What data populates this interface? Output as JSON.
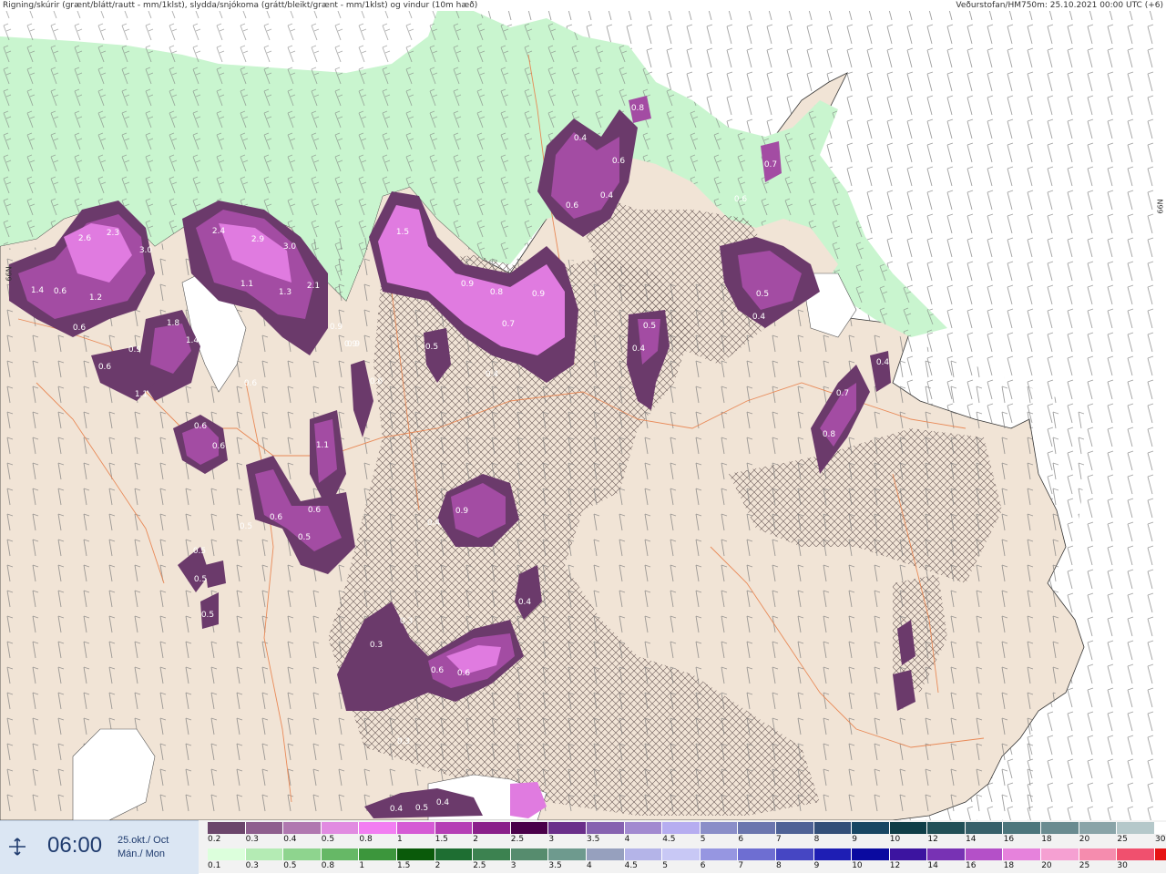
{
  "header": {
    "left_title": "Rigning/skúrir (grænt/blátt/rautt - mm/1klst), slydda/snjókoma (grátt/bleikt/grænt - mm/1klst) og vindur (10m hæð)",
    "right_title": "Veðurstofan/HM750m: 25.10.2021 00:00 UTC (+6)"
  },
  "map": {
    "lat_label_left": "66N",
    "lat_label_right": "66N",
    "colors": {
      "sea": "#ffffff",
      "land": "#f1e4d6",
      "rain_light": "#c9f5cf",
      "rain_mid": "#a6e0ad",
      "snow_dark": "#6b3a6b",
      "snow_mid": "#a34ca3",
      "snow_light": "#e07be0",
      "snow_bright": "#f5a3f5",
      "roads": "#e8804a"
    },
    "precip_labels": [
      "2.6",
      "2.3",
      "3.0",
      "2.4",
      "2.9",
      "3.0",
      "1.4",
      "0.6",
      "1.2",
      "0.6",
      "2.1",
      "1.1",
      "1.3",
      "1.8",
      "0.9",
      "1.4",
      "0.6",
      "1.1",
      "0.6",
      "1.5",
      "0.9",
      "0.8",
      "0.9",
      "0.7",
      "0.4",
      "0.5",
      "0.4",
      "0.4",
      "0.6",
      "0.6",
      "0.8",
      "0.4",
      "0.5",
      "0.4",
      "0.7",
      "0.8",
      "0.6",
      "0.5",
      "0.4",
      "0.6",
      "0.9",
      "0.6",
      "1.1",
      "0.6",
      "0.6",
      "0.5",
      "0.9",
      "0.4",
      "0.4",
      "0.5",
      "0.5",
      "0.5",
      "0.5",
      "0.3",
      "0.6",
      "0.6",
      "0.3",
      "0.3",
      "0.4",
      "0.5",
      "0.4",
      "0.7",
      "0.6",
      "0.9",
      "0.9"
    ]
  },
  "info": {
    "time": "06:00",
    "date_line1": "25.okt./ Oct",
    "date_line2": "Mán./ Mon",
    "icon": "snow-rain-icon"
  },
  "legend": {
    "snow_colors": [
      "#6b466b",
      "#8e5f8e",
      "#b078b0",
      "#e18be1",
      "#f27ef2",
      "#d55bd5",
      "#b53fb5",
      "#8a208a",
      "#4a004a",
      "#6a2f8a",
      "#8662b0",
      "#a28ad0",
      "#b6adf0",
      "#8a8ec8",
      "#6b76ae",
      "#4e6296",
      "#324f79",
      "#174663",
      "#0f3e48",
      "#214f57",
      "#37606a",
      "#4d767c",
      "#6a8b90",
      "#8aa4a8",
      "#b5c8ca",
      "#ffffff"
    ],
    "snow_labels": [
      "0.2",
      "0.3",
      "0.4",
      "0.5",
      "0.8",
      "1",
      "1.5",
      "2",
      "2.5",
      "3",
      "3.5",
      "4",
      "4.5",
      "5",
      "6",
      "7",
      "8",
      "9",
      "10",
      "12",
      "14",
      "16",
      "18",
      "20",
      "25",
      "30"
    ],
    "rain_colors": [
      "#dcffdc",
      "#b4ebb4",
      "#8ed48e",
      "#66b866",
      "#3c963c",
      "#0a5a0a",
      "#1e6e32",
      "#3c8250",
      "#568c6e",
      "#6e9a8e",
      "#96a0be",
      "#b4b4e8",
      "#c8c8f5",
      "#9696e1",
      "#6e6ed2",
      "#4646c3",
      "#1e1eb4",
      "#0a0aa0",
      "#3c14a0",
      "#7832b4",
      "#b450c8",
      "#e682dc",
      "#f5a0d2",
      "#f58cae",
      "#f0506e",
      "#e61414"
    ],
    "rain_labels": [
      "0.1",
      "0.3",
      "0.5",
      "0.8",
      "1",
      "1.5",
      "2",
      "2.5",
      "3",
      "3.5",
      "4",
      "4.5",
      "5",
      "6",
      "7",
      "8",
      "9",
      "10",
      "12",
      "14",
      "16",
      "18",
      "20",
      "25",
      "30"
    ]
  }
}
